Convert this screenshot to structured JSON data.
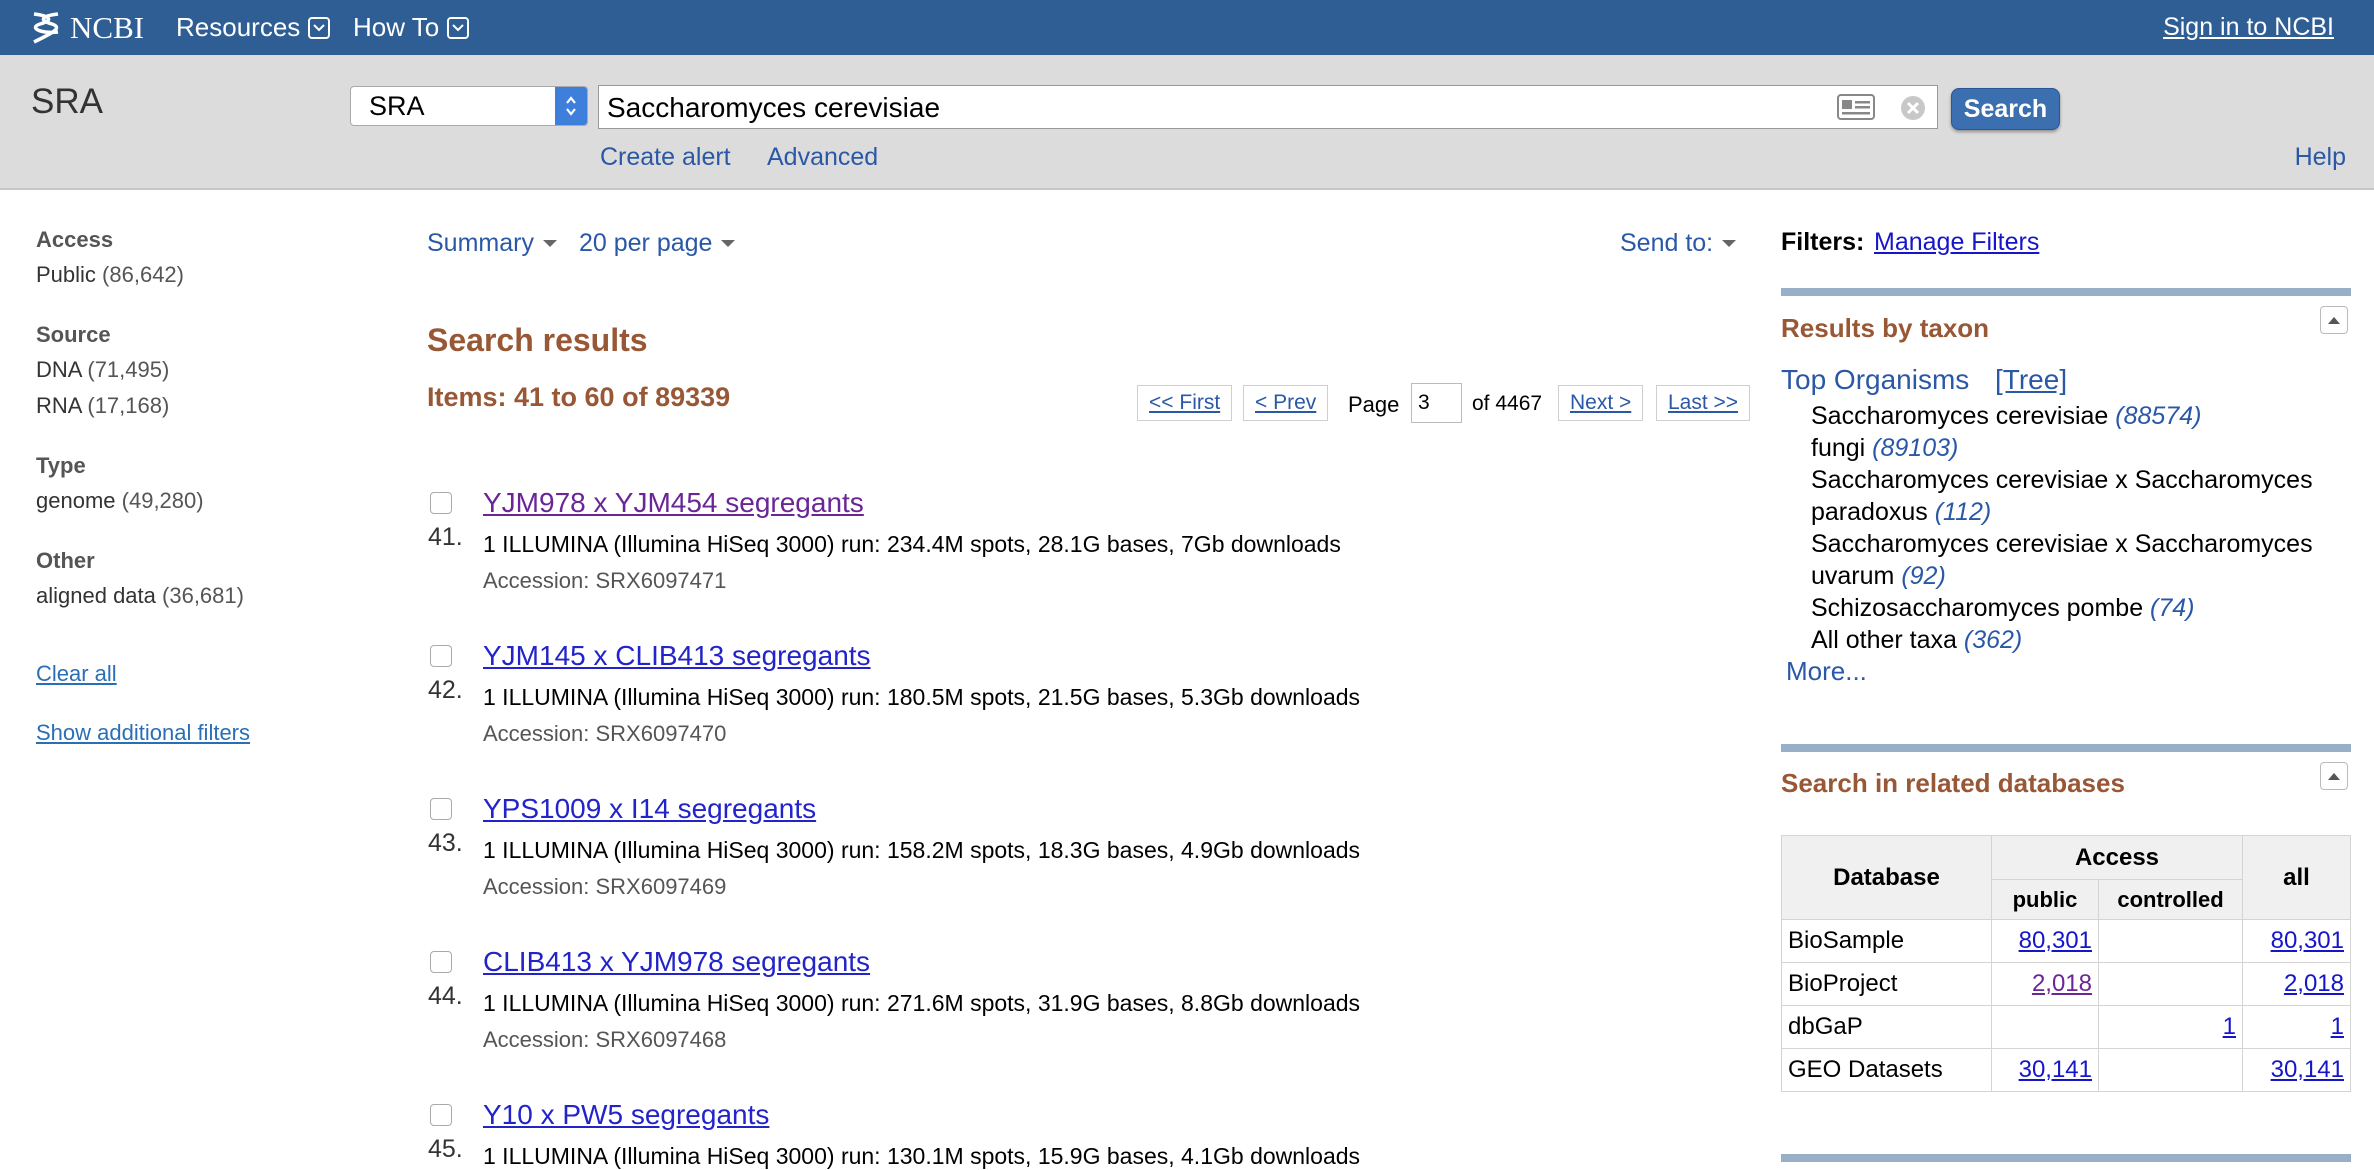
{
  "topbar": {
    "logo_text": "NCBI",
    "menus": [
      {
        "label": "Resources"
      },
      {
        "label": "How To"
      }
    ],
    "signin_label": "Sign in to NCBI"
  },
  "search": {
    "db_title": "SRA",
    "db_selected": "SRA",
    "query": "Saccharomyces cerevisiae",
    "button_label": "Search",
    "create_alert": "Create alert",
    "advanced": "Advanced",
    "help": "Help"
  },
  "filters": {
    "groups": [
      {
        "heading": "Access",
        "items": [
          {
            "label": "Public",
            "count": "(86,642)"
          }
        ]
      },
      {
        "heading": "Source",
        "items": [
          {
            "label": "DNA",
            "count": "(71,495)"
          },
          {
            "label": "RNA",
            "count": "(17,168)"
          }
        ]
      },
      {
        "heading": "Type",
        "items": [
          {
            "label": "genome",
            "count": "(49,280)"
          }
        ]
      },
      {
        "heading": "Other",
        "items": [
          {
            "label": "aligned data",
            "count": "(36,681)"
          }
        ]
      }
    ],
    "clear_all": "Clear all",
    "show_additional": "Show additional filters"
  },
  "display": {
    "format": "Summary",
    "per_page": "20 per page",
    "send_to": "Send to:"
  },
  "results": {
    "title": "Search results",
    "items_range": "Items: 41 to 60 of 89339",
    "pager": {
      "first": "<< First",
      "prev": "< Prev",
      "page_label": "Page",
      "page_value": "3",
      "of_pages": "of 4467",
      "next": "Next >",
      "last": "Last >>"
    },
    "items": [
      {
        "num": "41.",
        "title": "YJM978 x YJM454 segregants",
        "desc": "1 ILLUMINA (Illumina HiSeq 3000) run: 234.4M spots, 28.1G bases, 7Gb downloads",
        "accession": "Accession: SRX6097471"
      },
      {
        "num": "42.",
        "title": "YJM145 x CLIB413 segregants",
        "desc": "1 ILLUMINA (Illumina HiSeq 3000) run: 180.5M spots, 21.5G bases, 5.3Gb downloads",
        "accession": "Accession: SRX6097470"
      },
      {
        "num": "43.",
        "title": "YPS1009 x I14 segregants",
        "desc": "1 ILLUMINA (Illumina HiSeq 3000) run: 158.2M spots, 18.3G bases, 4.9Gb downloads",
        "accession": "Accession: SRX6097469"
      },
      {
        "num": "44.",
        "title": "CLIB413 x YJM978 segregants",
        "desc": "1 ILLUMINA (Illumina HiSeq 3000) run: 271.6M spots, 31.9G bases, 8.8Gb downloads",
        "accession": "Accession: SRX6097468"
      },
      {
        "num": "45.",
        "title": "Y10 x PW5 segregants",
        "desc": "1 ILLUMINA (Illumina HiSeq 3000) run: 130.1M spots, 15.9G bases, 4.1Gb downloads",
        "accession": ""
      }
    ]
  },
  "sidebar": {
    "filters_label": "Filters:",
    "manage_filters": "Manage Filters",
    "taxon": {
      "heading": "Results by taxon",
      "top_organisms": "Top Organisms",
      "tree": "[Tree]",
      "items": [
        {
          "name": "Saccharomyces cerevisiae",
          "count": "(88574)"
        },
        {
          "name": "fungi",
          "count": "(89103)"
        },
        {
          "name": "Saccharomyces cerevisiae x Saccharomyces paradoxus",
          "count": "(112)"
        },
        {
          "name": "Saccharomyces cerevisiae x Saccharomyces uvarum",
          "count": "(92)"
        },
        {
          "name": "Schizosaccharomyces pombe",
          "count": "(74)"
        },
        {
          "name": "All other taxa",
          "count": "(362)"
        }
      ],
      "more": "More..."
    },
    "related": {
      "heading": "Search in related databases",
      "headers": {
        "database": "Database",
        "access": "Access",
        "public": "public",
        "controlled": "controlled",
        "all": "all"
      },
      "rows": [
        {
          "db": "BioSample",
          "public": "80,301",
          "controlled": "",
          "all": "80,301"
        },
        {
          "db": "BioProject",
          "public": "2,018",
          "controlled": "",
          "all": "2,018"
        },
        {
          "db": "dbGaP",
          "public": "",
          "controlled": "1",
          "all": "1"
        },
        {
          "db": "GEO Datasets",
          "public": "30,141",
          "controlled": "",
          "all": "30,141"
        }
      ]
    }
  },
  "colors": {
    "topbar": "#2e5e93",
    "searchbar": "#dcdcdc",
    "heading_brown": "#985735",
    "link_blue": "#2a58a6",
    "result_link": "#2223c9",
    "visited": "#6a2596"
  }
}
